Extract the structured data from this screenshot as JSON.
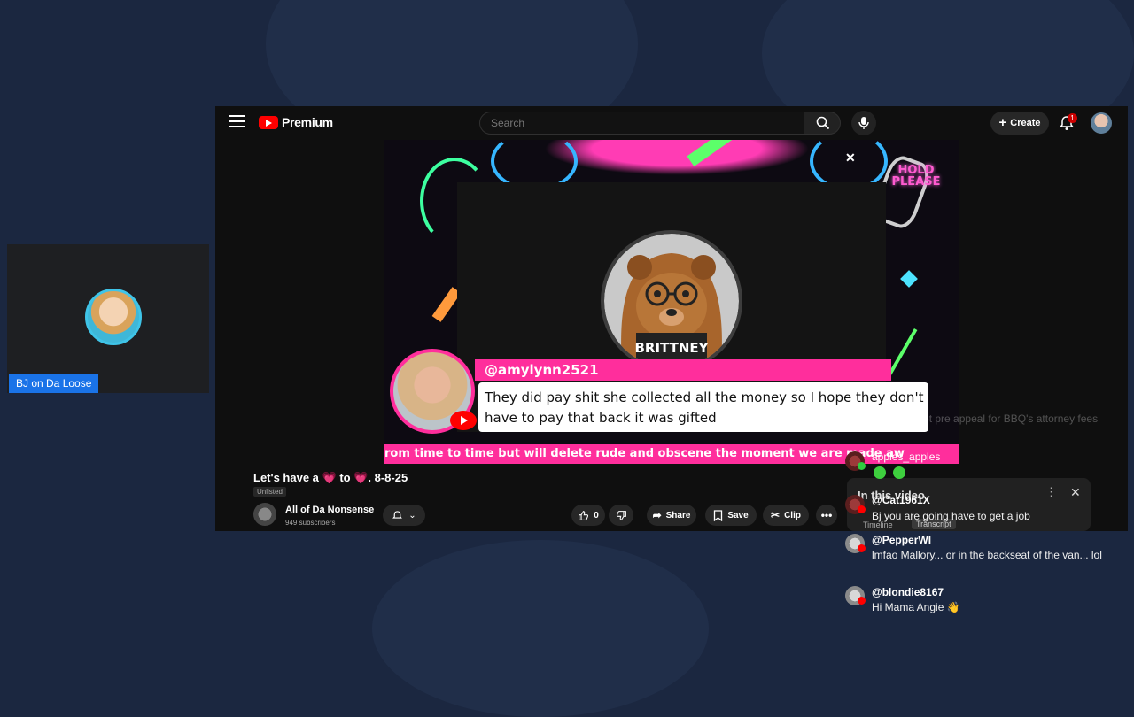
{
  "colors": {
    "accent": "#1a73e8",
    "brand": "#ff0000",
    "neon_pink": "#ff2e9c"
  },
  "participant": {
    "name": "BJ on Da Loose"
  },
  "header": {
    "logo_text": "Premium",
    "search_placeholder": "Search",
    "create_label": "Create",
    "notification_count": "1"
  },
  "video": {
    "hold_text": "HOLD PLEASE",
    "overlay_name": "BRITTNEY",
    "comment_user": "@amylynn2521",
    "comment_text": "They did pay shit she collected all the money so I hope they don't have to pay that back it was gifted",
    "ticker_text": "rom time to time but will delete rude and obscene the moment we are made aw"
  },
  "details": {
    "title": "Let's have a 💗 to 💗. 8-8-25",
    "visibility": "Unlisted",
    "channel_name": "All of Da Nonsense",
    "subscribers": "949 subscribers",
    "like_count": "0",
    "share_label": "Share",
    "save_label": "Save",
    "clip_label": "Clip"
  },
  "panel": {
    "title": "In this video",
    "tabs": [
      "Timeline",
      "Transcript"
    ]
  },
  "chat": {
    "faded_line": "in the docket pre appeal for BBQ's attorney fees",
    "messages": [
      {
        "user": "apples_apples",
        "text": ""
      },
      {
        "user": "@Cat1961X",
        "text": "Bj you are going have to get a job"
      },
      {
        "user": "@PepperWI",
        "text": "lmfao Mallory... or in the backseat of the van... lol"
      },
      {
        "user": "@blondie8167",
        "text": "Hi Mama Angie 👋"
      }
    ]
  }
}
